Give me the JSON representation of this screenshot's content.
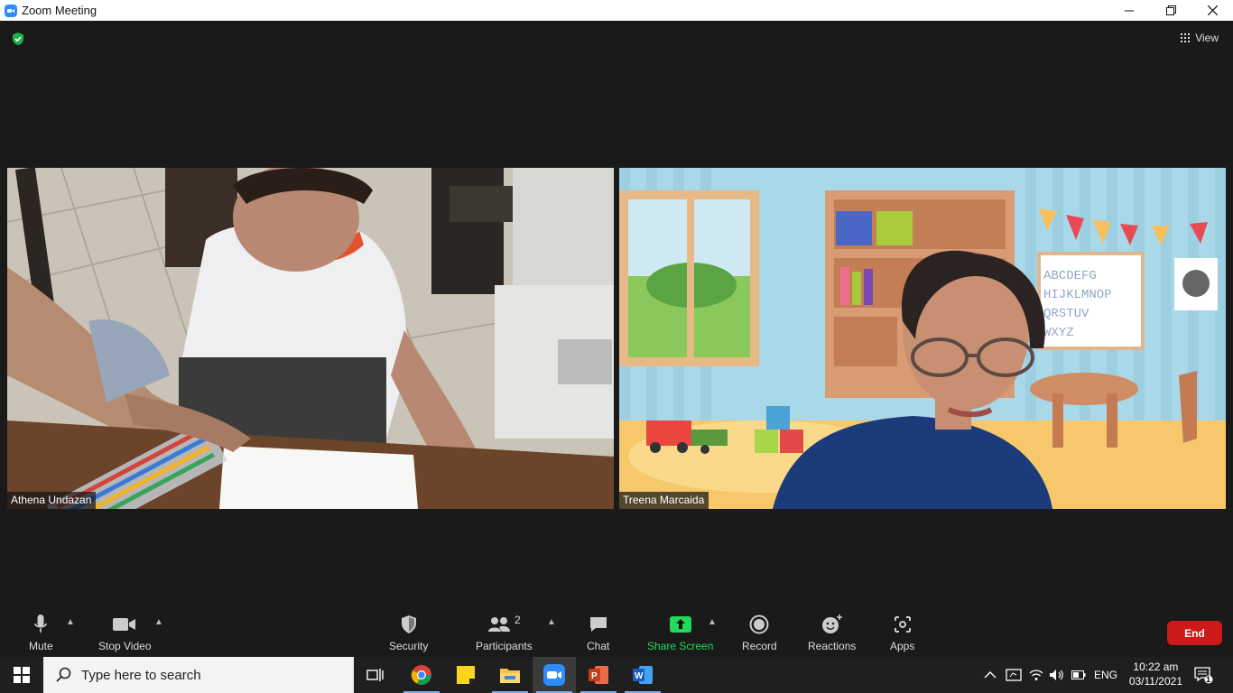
{
  "window": {
    "title": "Zoom Meeting"
  },
  "top_bar": {
    "view_label": "View"
  },
  "participants": [
    {
      "name": "Athena Undazan"
    },
    {
      "name": "Treena Marcaida"
    }
  ],
  "toolbar": {
    "mute": "Mute",
    "stop_video": "Stop Video",
    "security": "Security",
    "participants_label": "Participants",
    "participants_count": "2",
    "chat": "Chat",
    "share_screen": "Share Screen",
    "record": "Record",
    "reactions": "Reactions",
    "apps": "Apps",
    "end": "End"
  },
  "taskbar": {
    "search_placeholder": "Type here to search",
    "language": "ENG",
    "time": "10:22 am",
    "date": "03/11/2021",
    "notification_count": "1"
  },
  "colors": {
    "share_green": "#23d959",
    "end_red": "#cc1a1a",
    "zoom_blue": "#2d8cff"
  }
}
